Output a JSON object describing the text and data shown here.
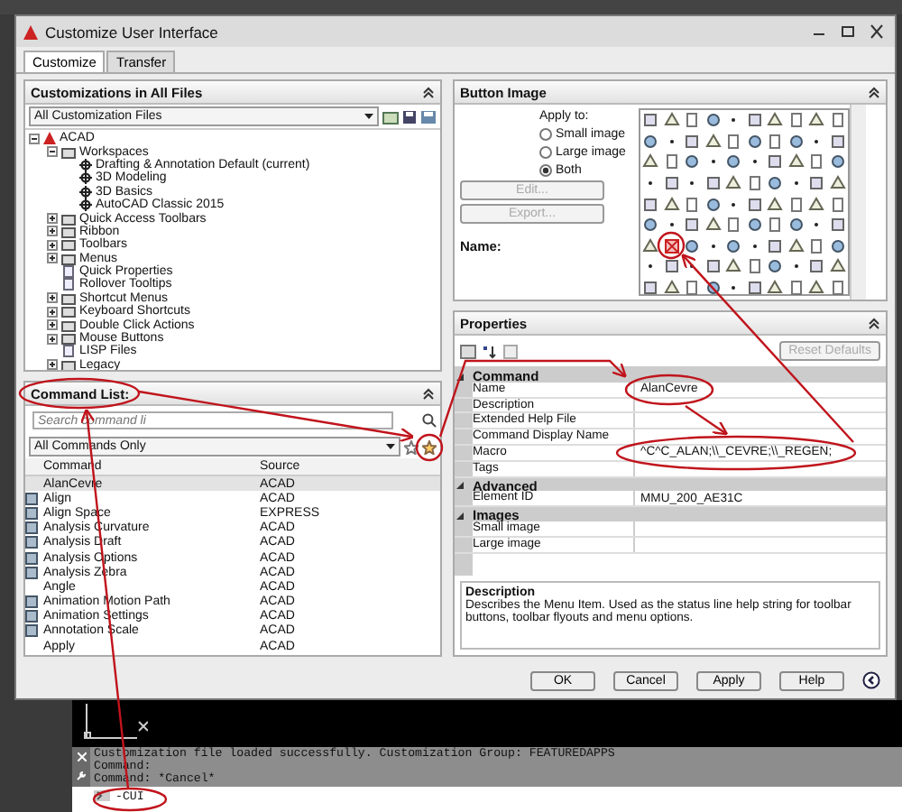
{
  "window": {
    "title": "Customize User Interface"
  },
  "tabs": [
    {
      "label": "Customize",
      "selected": true
    },
    {
      "label": "Transfer",
      "selected": false
    }
  ],
  "customizations": {
    "title": "Customizations in All Files",
    "filter": "All Customization Files",
    "tree": [
      {
        "label": "ACAD",
        "kind": "root",
        "expanded": true,
        "children": [
          {
            "label": "Workspaces",
            "kind": "group",
            "expanded": true,
            "children": [
              {
                "label": "Drafting & Annotation Default (current)",
                "kind": "gear"
              },
              {
                "label": "3D Modeling",
                "kind": "gear"
              },
              {
                "label": "3D Basics",
                "kind": "gear"
              },
              {
                "label": "AutoCAD Classic 2015",
                "kind": "gear"
              }
            ]
          },
          {
            "label": "Quick Access Toolbars",
            "kind": "group",
            "expanded": false
          },
          {
            "label": "Ribbon",
            "kind": "group",
            "expanded": false
          },
          {
            "label": "Toolbars",
            "kind": "group",
            "expanded": false
          },
          {
            "label": "Menus",
            "kind": "group",
            "expanded": false
          },
          {
            "label": "Quick Properties",
            "kind": "item"
          },
          {
            "label": "Rollover Tooltips",
            "kind": "item"
          },
          {
            "label": "Shortcut Menus",
            "kind": "group",
            "expanded": false
          },
          {
            "label": "Keyboard Shortcuts",
            "kind": "group",
            "expanded": false
          },
          {
            "label": "Double Click Actions",
            "kind": "group",
            "expanded": false
          },
          {
            "label": "Mouse Buttons",
            "kind": "group",
            "expanded": false
          },
          {
            "label": "LISP Files",
            "kind": "item"
          },
          {
            "label": "Legacy",
            "kind": "group",
            "expanded": false
          }
        ]
      }
    ]
  },
  "command_list": {
    "title": "Command List:",
    "search": {
      "placeholder": "Search command li"
    },
    "filter": "All Commands Only",
    "columns": [
      "Command",
      "Source"
    ],
    "rows": [
      {
        "command": "AlanCevre",
        "source": "ACAD",
        "selected": true,
        "has_icon": false
      },
      {
        "command": "Align",
        "source": "ACAD",
        "selected": false,
        "has_icon": true
      },
      {
        "command": "Align Space",
        "source": "EXPRESS",
        "selected": false,
        "has_icon": true
      },
      {
        "command": "Analysis Curvature",
        "source": "ACAD",
        "selected": false,
        "has_icon": true
      },
      {
        "command": "Analysis Draft",
        "source": "ACAD",
        "selected": false,
        "has_icon": true
      },
      {
        "command": "Analysis Options",
        "source": "ACAD",
        "selected": false,
        "has_icon": true
      },
      {
        "command": "Analysis Zebra",
        "source": "ACAD",
        "selected": false,
        "has_icon": true
      },
      {
        "command": "Angle",
        "source": "ACAD",
        "selected": false,
        "has_icon": false
      },
      {
        "command": "Animation Motion Path",
        "source": "ACAD",
        "selected": false,
        "has_icon": true
      },
      {
        "command": "Animation Settings",
        "source": "ACAD",
        "selected": false,
        "has_icon": true
      },
      {
        "command": "Annotation Scale",
        "source": "ACAD",
        "selected": false,
        "has_icon": true
      },
      {
        "command": "Apply",
        "source": "ACAD",
        "selected": false,
        "has_icon": false
      }
    ]
  },
  "button_image": {
    "title": "Button Image",
    "apply_to_label": "Apply to:",
    "options": [
      {
        "label": "Small image",
        "selected": false
      },
      {
        "label": "Large image",
        "selected": false
      },
      {
        "label": "Both",
        "selected": true
      }
    ],
    "buttons": [
      {
        "label": "Edit...",
        "disabled": true
      },
      {
        "label": "Export...",
        "disabled": true
      }
    ],
    "name_label": "Name:"
  },
  "properties": {
    "title": "Properties",
    "reset_button": "Reset Defaults",
    "sections": [
      {
        "title": "Command",
        "expanded": true,
        "rows": [
          {
            "name": "Name",
            "value": "AlanCevre"
          },
          {
            "name": "Description",
            "value": ""
          },
          {
            "name": "Extended Help File",
            "value": ""
          },
          {
            "name": "Command Display Name",
            "value": ""
          },
          {
            "name": "Macro",
            "value": "^C^C_ALAN;\\\\_CEVRE;\\\\_REGEN;"
          },
          {
            "name": "Tags",
            "value": ""
          }
        ]
      },
      {
        "title": "Advanced",
        "expanded": true,
        "rows": [
          {
            "name": "Element ID",
            "value": "MMU_200_AE31C"
          }
        ]
      },
      {
        "title": "Images",
        "expanded": true,
        "rows": [
          {
            "name": "Small image",
            "value": ""
          },
          {
            "name": "Large image",
            "value": ""
          }
        ]
      }
    ],
    "description_title": "Description",
    "description_text": "Describes the Menu Item. Used as the status line help string for toolbar buttons, toolbar flyouts and menu options."
  },
  "footer_buttons": [
    "OK",
    "Cancel",
    "Apply",
    "Help"
  ],
  "command_line": {
    "history": [
      "Customization file loaded successfully. Customization Group: FEATUREDAPPS",
      "Command:",
      "Command: *Cancel*"
    ],
    "input": "-CUI"
  }
}
